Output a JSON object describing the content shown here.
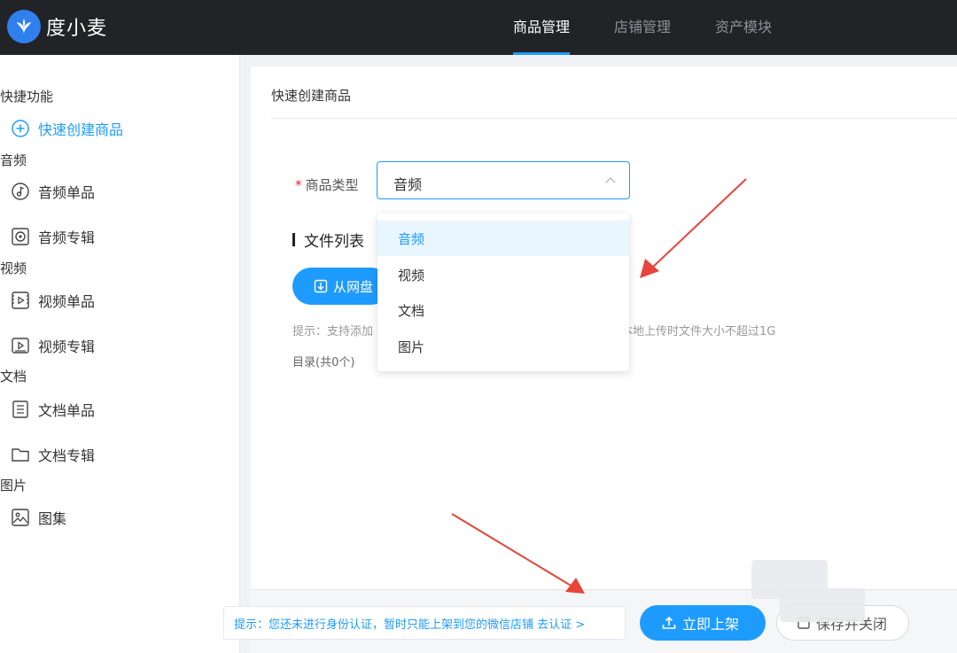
{
  "header": {
    "brand": "度小麦",
    "nav": [
      "商品管理",
      "店铺管理",
      "资产模块"
    ]
  },
  "sidebar": {
    "groups": [
      {
        "title": "快捷功能",
        "items": [
          {
            "label": "快速创建商品",
            "icon": "plus-circle-icon"
          }
        ]
      },
      {
        "title": "音频",
        "items": [
          {
            "label": "音频单品",
            "icon": "music-note-icon"
          },
          {
            "label": "音频专辑",
            "icon": "album-icon"
          }
        ]
      },
      {
        "title": "视频",
        "items": [
          {
            "label": "视频单品",
            "icon": "video-file-icon"
          },
          {
            "label": "视频专辑",
            "icon": "video-album-icon"
          }
        ]
      },
      {
        "title": "文档",
        "items": [
          {
            "label": "文档单品",
            "icon": "document-icon"
          },
          {
            "label": "文档专辑",
            "icon": "folder-icon"
          }
        ]
      },
      {
        "title": "图片",
        "items": [
          {
            "label": "图集",
            "icon": "image-icon"
          }
        ]
      }
    ]
  },
  "main": {
    "title": "快速创建商品",
    "type_label": "商品类型",
    "type_value": "音频",
    "file_list_title": "文件列表",
    "upload_label": "从网盘",
    "hint_left": "提示：支持添加",
    "hint_right": "本地上传时文件大小不超过1G",
    "dir_count": "目录(共0个)"
  },
  "dropdown": {
    "options": [
      "音频",
      "视频",
      "文档",
      "图片"
    ],
    "selected": "音频"
  },
  "footer": {
    "notice": "提示：您还未进行身份认证，暂时只能上架到您的微信店铺 去认证 >",
    "publish_label": "立即上架",
    "save_label": "保存并关闭"
  },
  "colors": {
    "accent": "#1e9bff",
    "header_bg": "#222326",
    "annotation_arrow": "#e8443a"
  }
}
